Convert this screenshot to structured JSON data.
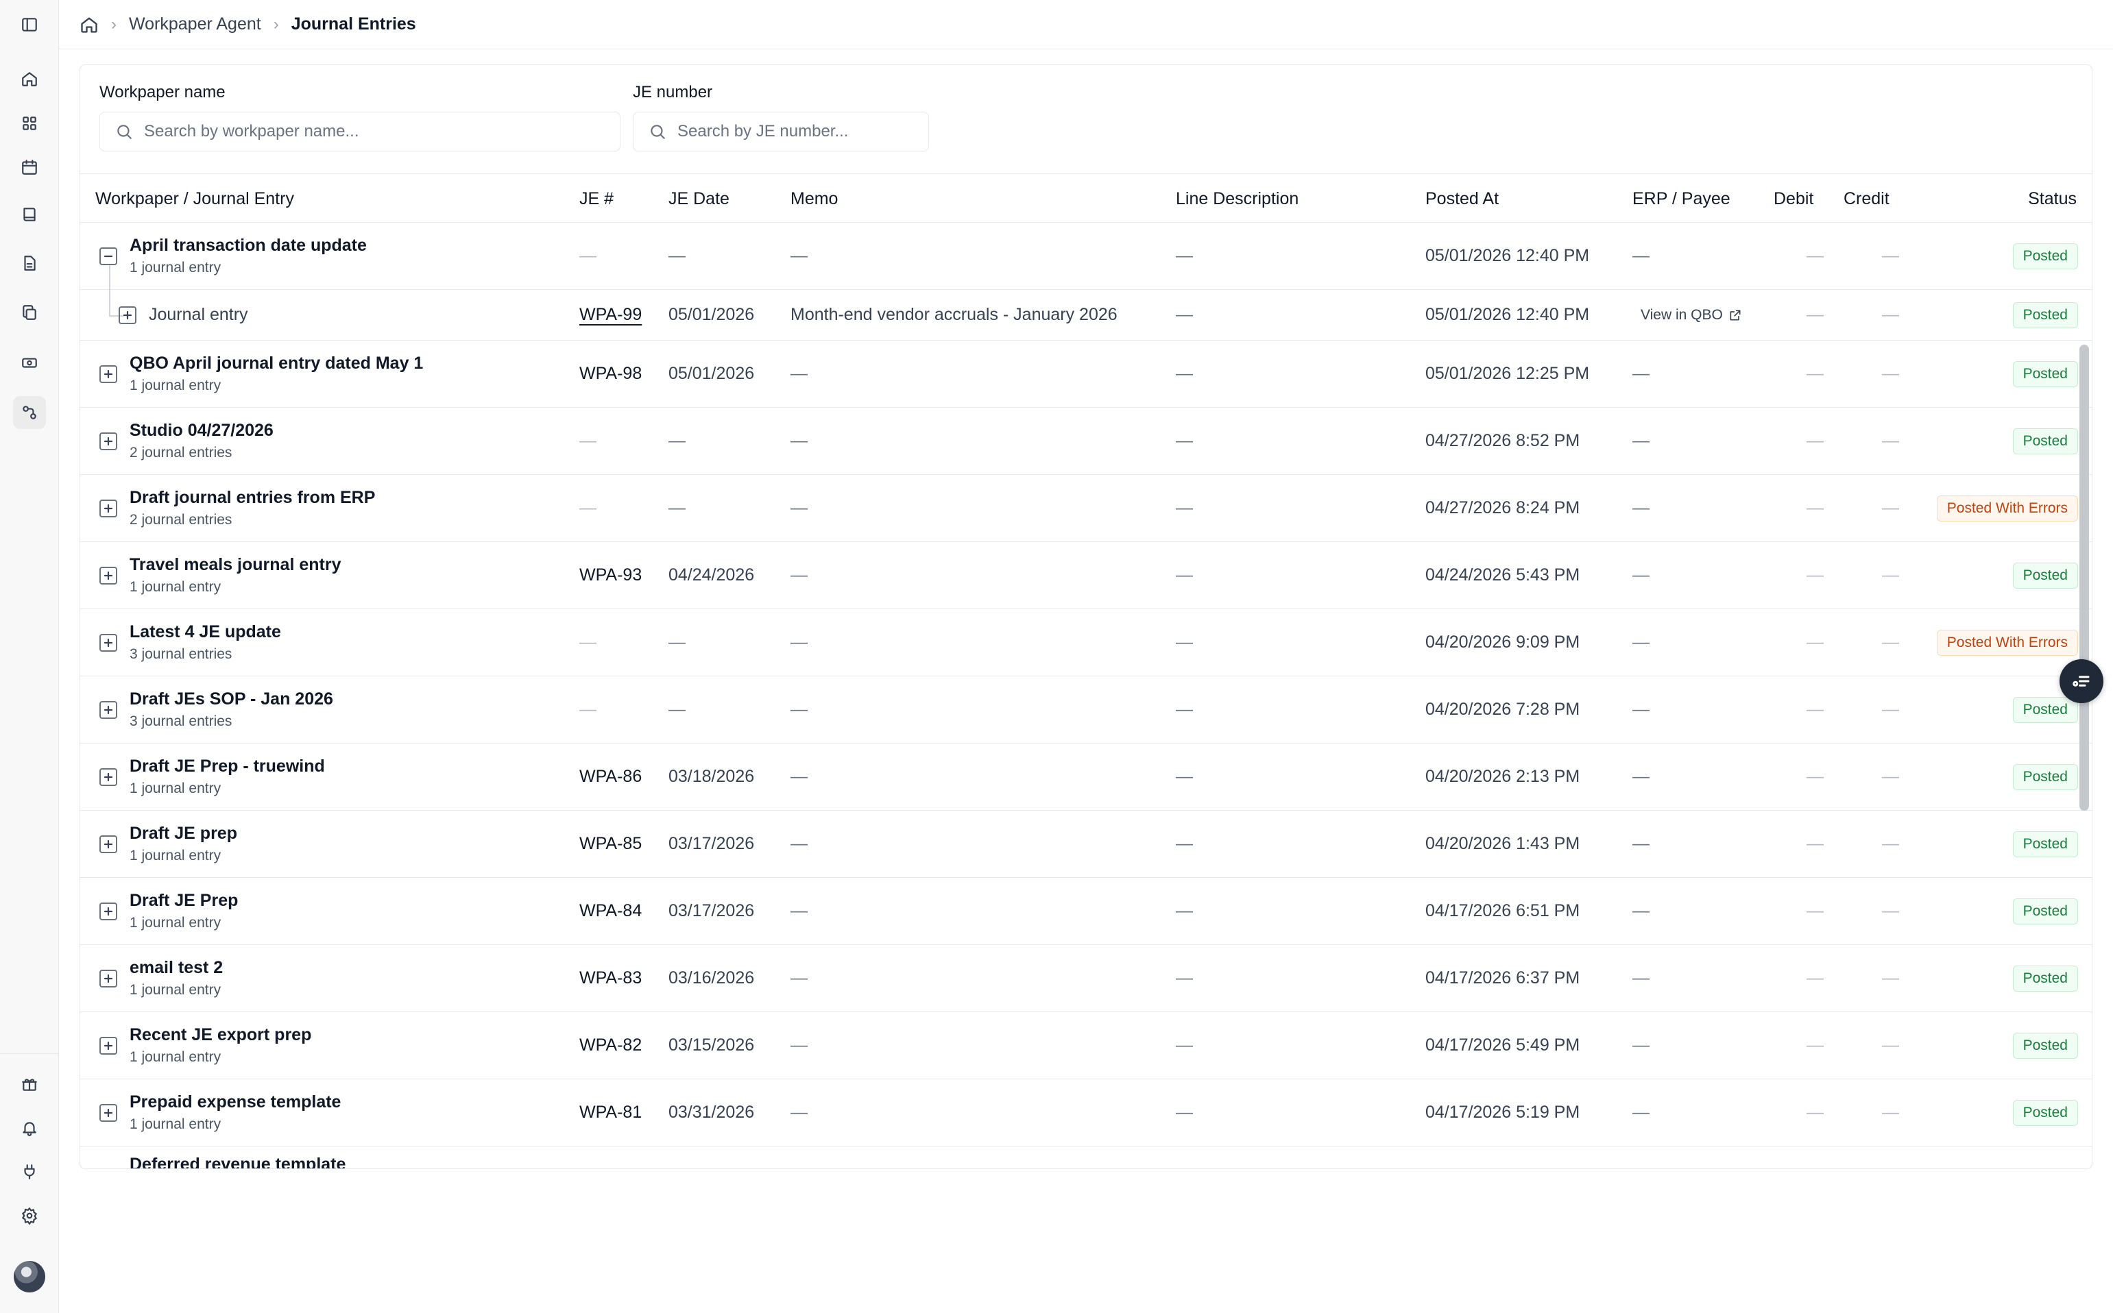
{
  "breadcrumb": {
    "items": [
      "Workpaper Agent",
      "Journal Entries"
    ]
  },
  "filters": {
    "workpaper": {
      "label": "Workpaper name",
      "placeholder": "Search by workpaper name..."
    },
    "je": {
      "label": "JE number",
      "placeholder": "Search by JE number..."
    }
  },
  "columns": [
    "Workpaper / Journal Entry",
    "JE #",
    "JE Date",
    "Memo",
    "Line Description",
    "Posted At",
    "ERP / Payee",
    "Debit",
    "Credit",
    "Status"
  ],
  "dash": "—",
  "rows": [
    {
      "title": "April transaction date update",
      "subtitle": "1 journal entry",
      "je": "—",
      "date": "—",
      "memo": "—",
      "line": "—",
      "posted_at": "05/01/2026 12:40 PM",
      "erp": "—",
      "status": "Posted",
      "expanded": true
    },
    {
      "child": true,
      "title": "Journal entry",
      "je": "WPA-99",
      "date": "05/01/2026",
      "memo": "Month-end vendor accruals - January 2026",
      "line": "—",
      "posted_at": "05/01/2026 12:40 PM",
      "erp": "View in QBO",
      "status": "Posted"
    },
    {
      "title": "QBO April journal entry dated May 1",
      "subtitle": "1 journal entry",
      "je": "WPA-98",
      "date": "05/01/2026",
      "memo": "—",
      "line": "—",
      "posted_at": "05/01/2026 12:25 PM",
      "erp": "—",
      "status": "Posted"
    },
    {
      "title": "Studio 04/27/2026",
      "subtitle": "2 journal entries",
      "je": "—",
      "date": "—",
      "memo": "—",
      "line": "—",
      "posted_at": "04/27/2026 8:52 PM",
      "erp": "—",
      "status": "Posted"
    },
    {
      "title": "Draft journal entries from ERP",
      "subtitle": "2 journal entries",
      "je": "—",
      "date": "—",
      "memo": "—",
      "line": "—",
      "posted_at": "04/27/2026 8:24 PM",
      "erp": "—",
      "status": "Posted With Errors"
    },
    {
      "title": "Travel meals journal entry",
      "subtitle": "1 journal entry",
      "je": "WPA-93",
      "date": "04/24/2026",
      "memo": "—",
      "line": "—",
      "posted_at": "04/24/2026 5:43 PM",
      "erp": "—",
      "status": "Posted"
    },
    {
      "title": "Latest 4 JE update",
      "subtitle": "3 journal entries",
      "je": "—",
      "date": "—",
      "memo": "—",
      "line": "—",
      "posted_at": "04/20/2026 9:09 PM",
      "erp": "—",
      "status": "Posted With Errors"
    },
    {
      "title": "Draft JEs SOP - Jan 2026",
      "subtitle": "3 journal entries",
      "je": "—",
      "date": "—",
      "memo": "—",
      "line": "—",
      "posted_at": "04/20/2026 7:28 PM",
      "erp": "—",
      "status": "Posted"
    },
    {
      "title": "Draft JE Prep - truewind",
      "subtitle": "1 journal entry",
      "je": "WPA-86",
      "date": "03/18/2026",
      "memo": "—",
      "line": "—",
      "posted_at": "04/20/2026 2:13 PM",
      "erp": "—",
      "status": "Posted"
    },
    {
      "title": "Draft JE prep",
      "subtitle": "1 journal entry",
      "je": "WPA-85",
      "date": "03/17/2026",
      "memo": "—",
      "line": "—",
      "posted_at": "04/20/2026 1:43 PM",
      "erp": "—",
      "status": "Posted"
    },
    {
      "title": "Draft JE Prep",
      "subtitle": "1 journal entry",
      "je": "WPA-84",
      "date": "03/17/2026",
      "memo": "—",
      "line": "—",
      "posted_at": "04/17/2026 6:51 PM",
      "erp": "—",
      "status": "Posted"
    },
    {
      "title": "email test 2",
      "subtitle": "1 journal entry",
      "je": "WPA-83",
      "date": "03/16/2026",
      "memo": "—",
      "line": "—",
      "posted_at": "04/17/2026 6:37 PM",
      "erp": "—",
      "status": "Posted"
    },
    {
      "title": "Recent JE export prep",
      "subtitle": "1 journal entry",
      "je": "WPA-82",
      "date": "03/15/2026",
      "memo": "—",
      "line": "—",
      "posted_at": "04/17/2026 5:49 PM",
      "erp": "—",
      "status": "Posted"
    },
    {
      "title": "Prepaid expense template",
      "subtitle": "1 journal entry",
      "je": "WPA-81",
      "date": "03/31/2026",
      "memo": "—",
      "line": "—",
      "posted_at": "04/17/2026 5:19 PM",
      "erp": "—",
      "status": "Posted"
    },
    {
      "title": "Deferred revenue template",
      "subtitle": "",
      "je": "",
      "date": "",
      "memo": "",
      "line": "",
      "posted_at": "",
      "erp": "",
      "status": "",
      "partial": true
    }
  ]
}
